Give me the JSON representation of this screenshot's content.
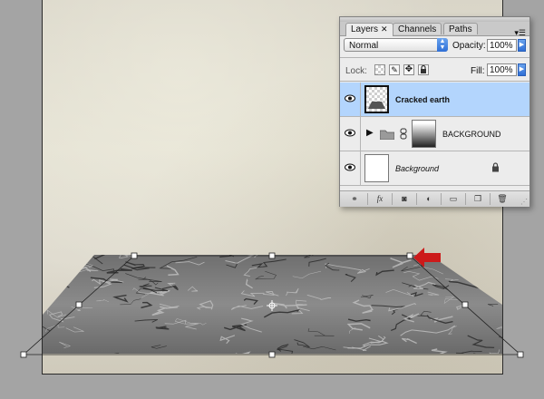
{
  "layers_panel": {
    "tabs": [
      {
        "label": "Layers",
        "active": true
      },
      {
        "label": "Channels",
        "active": false
      },
      {
        "label": "Paths",
        "active": false
      }
    ],
    "blend_mode": "Normal",
    "opacity_label": "Opacity:",
    "opacity_value": "100%",
    "lock_label": "Lock:",
    "fill_label": "Fill:",
    "fill_value": "100%",
    "layers": [
      {
        "name": "Cracked earth",
        "selected": true,
        "visible": true
      },
      {
        "name": "BACKGROUND",
        "type": "group",
        "visible": true
      },
      {
        "name": "Background",
        "locked": true,
        "visible": true
      }
    ],
    "footer_icons": [
      "link-icon",
      "fx-icon",
      "mask-icon",
      "adjustment-icon",
      "folder-icon",
      "new-layer-icon",
      "trash-icon"
    ]
  },
  "canvas": {
    "layer_content": "cracked earth texture in perspective transform",
    "arrow_color": "#cc1a1a",
    "selected_color": "#b3d5fd"
  }
}
